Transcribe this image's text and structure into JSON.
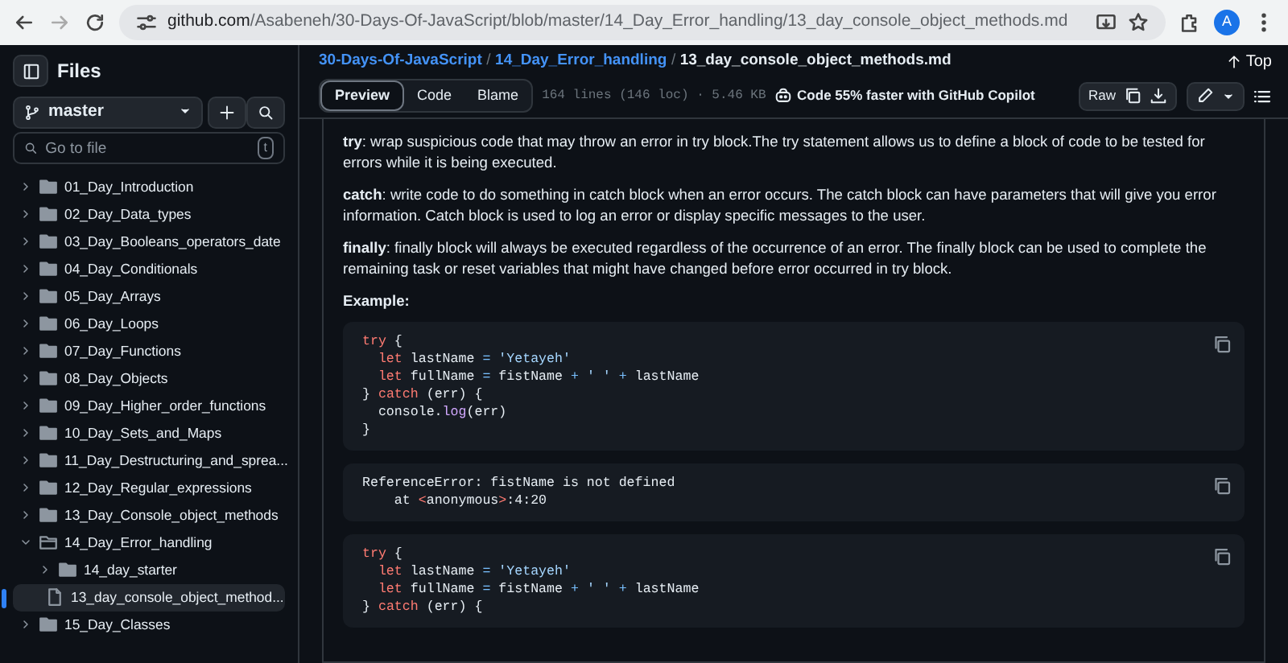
{
  "browser": {
    "url_host": "github.com",
    "url_path": "/Asabeneh/30-Days-Of-JavaScript/blob/master/14_Day_Error_handling/13_day_console_object_methods.md",
    "profile_initial": "A"
  },
  "sidebar": {
    "title": "Files",
    "branch": "master",
    "search": {
      "placeholder": "Go to file",
      "shortcut": "t"
    },
    "tree": [
      {
        "label": "01_Day_Introduction",
        "kind": "folder",
        "expanded": false,
        "selected": false
      },
      {
        "label": "02_Day_Data_types",
        "kind": "folder",
        "expanded": false,
        "selected": false
      },
      {
        "label": "03_Day_Booleans_operators_date",
        "kind": "folder",
        "expanded": false,
        "selected": false
      },
      {
        "label": "04_Day_Conditionals",
        "kind": "folder",
        "expanded": false,
        "selected": false
      },
      {
        "label": "05_Day_Arrays",
        "kind": "folder",
        "expanded": false,
        "selected": false
      },
      {
        "label": "06_Day_Loops",
        "kind": "folder",
        "expanded": false,
        "selected": false
      },
      {
        "label": "07_Day_Functions",
        "kind": "folder",
        "expanded": false,
        "selected": false
      },
      {
        "label": "08_Day_Objects",
        "kind": "folder",
        "expanded": false,
        "selected": false
      },
      {
        "label": "09_Day_Higher_order_functions",
        "kind": "folder",
        "expanded": false,
        "selected": false
      },
      {
        "label": "10_Day_Sets_and_Maps",
        "kind": "folder",
        "expanded": false,
        "selected": false
      },
      {
        "label": "11_Day_Destructuring_and_sprea...",
        "kind": "folder",
        "expanded": false,
        "selected": false
      },
      {
        "label": "12_Day_Regular_expressions",
        "kind": "folder",
        "expanded": false,
        "selected": false
      },
      {
        "label": "13_Day_Console_object_methods",
        "kind": "folder",
        "expanded": false,
        "selected": false
      },
      {
        "label": "14_Day_Error_handling",
        "kind": "folder",
        "expanded": true,
        "selected": false,
        "children": [
          {
            "label": "14_day_starter",
            "kind": "folder",
            "expanded": false,
            "selected": false
          },
          {
            "label": "13_day_console_object_method...",
            "kind": "file",
            "selected": true
          }
        ]
      },
      {
        "label": "15_Day_Classes",
        "kind": "folder",
        "expanded": false,
        "selected": false
      }
    ]
  },
  "breadcrumb": [
    {
      "label": "30-Days-Of-JavaScript",
      "separator": "/"
    },
    {
      "label": "14_Day_Error_handling",
      "separator": "/"
    }
  ],
  "file_name": "13_day_console_object_methods.md",
  "top_link": "Top",
  "view_tabs": [
    {
      "label": "Preview",
      "selected": true
    },
    {
      "label": "Code",
      "selected": false
    },
    {
      "label": "Blame",
      "selected": false
    }
  ],
  "file_info": "164 lines (146 loc) · 5.46 KB",
  "copilot_promo": "Code 55% faster with GitHub Copilot",
  "raw_button": "Raw",
  "content": [
    {
      "kind": "para",
      "text": "**try**: wrap suspicious code that may throw an error in try block.The try statement allows us to define a block of code to be tested for errors while it is being executed."
    },
    {
      "kind": "para",
      "text": "**catch**: write code to do something in catch block when an error occurs. The catch block can have parameters that will give you error information. Catch block is used to log an error or display specific messages to the user."
    },
    {
      "kind": "para",
      "text": "**finally**: finally block will always be executed regardless of the occurrence of an error. The finally block can be used to complete the remaining task or reset variables that might have changed before error occurred in try block."
    },
    {
      "kind": "heading",
      "text": "Example:"
    },
    {
      "kind": "code",
      "lines": [
        [
          {
            "kw": "try"
          },
          {
            "plain": " {"
          }
        ],
        [
          {
            "kw": "  let"
          },
          {
            "plain": " lastName "
          },
          {
            "op": "="
          },
          {
            "str": " 'Yetayeh'"
          }
        ],
        [
          {
            "kw": "  let"
          },
          {
            "plain": " fullName "
          },
          {
            "op": "="
          },
          {
            "plain": " fistName "
          },
          {
            "op": "+"
          },
          {
            "str": " ' ' "
          },
          {
            "op": "+"
          },
          {
            "plain": " lastName"
          }
        ],
        [
          {
            "plain": "} "
          },
          {
            "kw": "catch"
          },
          {
            "plain": " (err) {"
          }
        ],
        [
          {
            "plain": "  console."
          },
          {
            "fn": "log"
          },
          {
            "plain": "(err)"
          }
        ],
        [
          {
            "plain": "}"
          }
        ]
      ]
    },
    {
      "kind": "code",
      "lines": [
        [
          {
            "plain": "ReferenceError: fistName is not defined"
          }
        ],
        [
          {
            "plain": "    at "
          },
          {
            "kw": "<"
          },
          {
            "plain": "anonymous"
          },
          {
            "kw": ">"
          },
          {
            "plain": ":4:20"
          }
        ]
      ]
    },
    {
      "kind": "code",
      "lines": [
        [
          {
            "kw": "try"
          },
          {
            "plain": " {"
          }
        ],
        [
          {
            "kw": "  let"
          },
          {
            "plain": " lastName "
          },
          {
            "op": "="
          },
          {
            "str": " 'Yetayeh'"
          }
        ],
        [
          {
            "kw": "  let"
          },
          {
            "plain": " fullName "
          },
          {
            "op": "="
          },
          {
            "plain": " fistName "
          },
          {
            "op": "+"
          },
          {
            "str": " ' ' "
          },
          {
            "op": "+"
          },
          {
            "plain": " lastName"
          }
        ],
        [
          {
            "plain": "} "
          },
          {
            "kw": "catch"
          },
          {
            "plain": " (err) {"
          }
        ]
      ]
    }
  ]
}
